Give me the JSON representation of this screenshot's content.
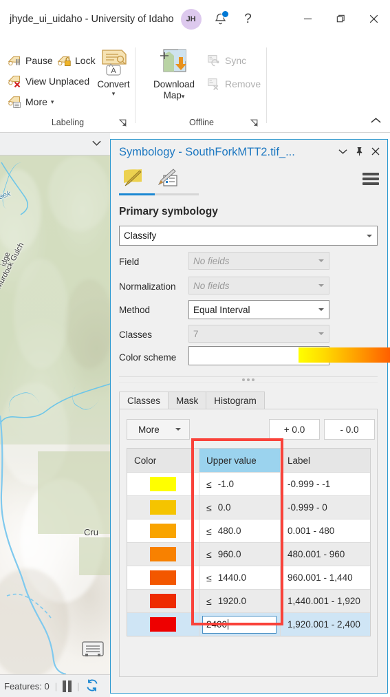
{
  "titlebar": {
    "title": "jhyde_ui_uidaho - University of Idaho",
    "avatar_initials": "JH",
    "notifications_icon": "bell-icon",
    "help_label": "?",
    "minimize_icon": "minimize-icon",
    "restore_icon": "restore-icon",
    "close_icon": "close-icon",
    "accent_color": "#0078d4"
  },
  "ribbon": {
    "groups": [
      {
        "name": "Labeling",
        "label": "Labeling",
        "small_buttons": [
          {
            "label": "Pause",
            "icon": "label-pause-icon",
            "disabled": false
          },
          {
            "label": "Lock",
            "icon": "label-lock-icon",
            "disabled": false
          },
          {
            "label": "View Unplaced",
            "icon": "label-view-unplaced-icon",
            "disabled": false
          },
          {
            "label": "More",
            "icon": "label-more-icon",
            "disabled": false,
            "has_menu": true
          }
        ],
        "big_buttons": [
          {
            "label_line1": "Convert",
            "label_line2": "",
            "icon": "convert-labels-icon",
            "has_menu": true
          }
        ]
      },
      {
        "name": "Offline",
        "label": "Offline",
        "small_buttons": [
          {
            "label": "Sync",
            "icon": "sync-icon",
            "disabled": true
          },
          {
            "label": "Remove",
            "icon": "remove-icon",
            "disabled": true
          }
        ],
        "big_buttons": [
          {
            "label_line1": "Download",
            "label_line2": "Map",
            "icon": "download-map-icon",
            "has_menu": true
          }
        ]
      }
    ],
    "collapse_icon": "chevron-up-icon"
  },
  "map": {
    "collapse_icon": "chevron-down-icon",
    "labels": [
      {
        "text": "Murdock Gulch",
        "type": "feature"
      },
      {
        "text": "idge",
        "type": "feature"
      },
      {
        "text": "Cru",
        "type": "feature"
      },
      {
        "text": "eek",
        "type": "water"
      }
    ],
    "attribution_icon": "basemap-attribution-icon",
    "status": {
      "features_label": "Features: 0",
      "pause_icon": "pause-drawing-icon",
      "refresh_icon": "refresh-icon"
    }
  },
  "panel": {
    "title": "Symbology - SouthForkMTT2.tif_...",
    "title_color": "#1d78c1",
    "menu_icon": "panel-menu-icon",
    "dropdown_icon": "chevron-down-icon",
    "pin_icon": "pin-icon",
    "close_icon": "close-icon",
    "tabs": [
      {
        "name": "symbology",
        "icon": "symbology-brush-icon",
        "active": true
      },
      {
        "name": "variables",
        "icon": "symbology-variables-icon",
        "active": false
      }
    ],
    "section_title": "Primary symbology",
    "primary_symbology": {
      "value": "Classify",
      "options": [
        "Classify"
      ]
    },
    "fields": [
      {
        "label": "Field",
        "value": "",
        "placeholder": "No fields",
        "disabled": true
      },
      {
        "label": "Normalization",
        "value": "",
        "placeholder": "No fields",
        "disabled": true
      },
      {
        "label": "Method",
        "value": "Equal Interval",
        "disabled": false
      },
      {
        "label": "Classes",
        "value": "7",
        "disabled": true
      },
      {
        "label": "Color scheme",
        "value": "Yellow to Red",
        "disabled": false,
        "is_ramp": true
      }
    ],
    "color_ramp_stops": [
      "#ffff00",
      "#ffd800",
      "#ff9a00",
      "#ff5500",
      "#fa0000"
    ],
    "inner_tabs": [
      {
        "label": "Classes",
        "active": true
      },
      {
        "label": "Mask",
        "active": false
      },
      {
        "label": "Histogram",
        "active": false
      }
    ],
    "toolbar": {
      "more_label": "More",
      "plus_label": "+ 0.0",
      "minus_label": "- 0.0"
    },
    "table": {
      "headers": [
        "Color",
        "Upper value",
        "Label"
      ],
      "highlighted_header": "Upper value",
      "rows": [
        {
          "color": "#ffff00",
          "operator": "≤",
          "upper": "-1.0",
          "label": "-0.999 - -1",
          "selected": false,
          "editing": false
        },
        {
          "color": "#f5c400",
          "operator": "≤",
          "upper": "0.0",
          "label": "-0.999 - 0",
          "selected": false,
          "editing": false
        },
        {
          "color": "#f9a400",
          "operator": "≤",
          "upper": "480.0",
          "label": "0.001 - 480",
          "selected": false,
          "editing": false
        },
        {
          "color": "#f88100",
          "operator": "≤",
          "upper": "960.0",
          "label": "480.001 - 960",
          "selected": false,
          "editing": false
        },
        {
          "color": "#f35700",
          "operator": "≤",
          "upper": "1440.0",
          "label": "960.001 - 1,440",
          "selected": false,
          "editing": false
        },
        {
          "color": "#ee2b00",
          "operator": "≤",
          "upper": "1920.0",
          "label": "1,440.001 - 1,920",
          "selected": false,
          "editing": false
        },
        {
          "color": "#ee0000",
          "operator": "",
          "upper": "2400",
          "label": "1,920.001 - 2,400",
          "selected": true,
          "editing": true
        }
      ]
    },
    "annotation": {
      "shape": "rectangle",
      "color": "#f9423a",
      "target": "Upper value column"
    }
  }
}
